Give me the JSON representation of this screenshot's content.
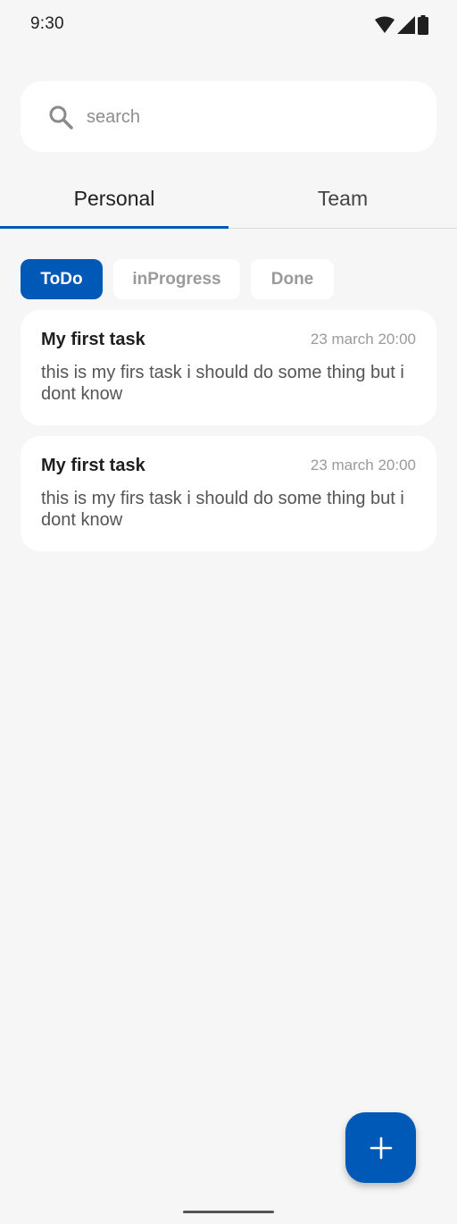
{
  "status_bar": {
    "time": "9:30",
    "icons": [
      "wifi-icon",
      "signal-icon",
      "battery-icon"
    ]
  },
  "search": {
    "placeholder": "search",
    "icon": "search-icon"
  },
  "tabs": [
    {
      "label": "Personal",
      "active": true
    },
    {
      "label": "Team",
      "active": false
    }
  ],
  "filters": [
    {
      "label": "ToDo",
      "active": true
    },
    {
      "label": "inProgress",
      "active": false
    },
    {
      "label": "Done",
      "active": false
    }
  ],
  "tasks": [
    {
      "title": "My first task",
      "date": "23 march 20:00",
      "description": "this is my firs task i should do some thing but i dont know"
    },
    {
      "title": "My first task",
      "date": "23 march 20:00",
      "description": "this is my firs task i should do some thing but i dont know"
    }
  ],
  "fab": {
    "icon": "plus-icon"
  },
  "colors": {
    "accent": "#0058b7",
    "background": "#f6f6f6",
    "card": "#ffffff",
    "muted_text": "#9a9a9a"
  }
}
